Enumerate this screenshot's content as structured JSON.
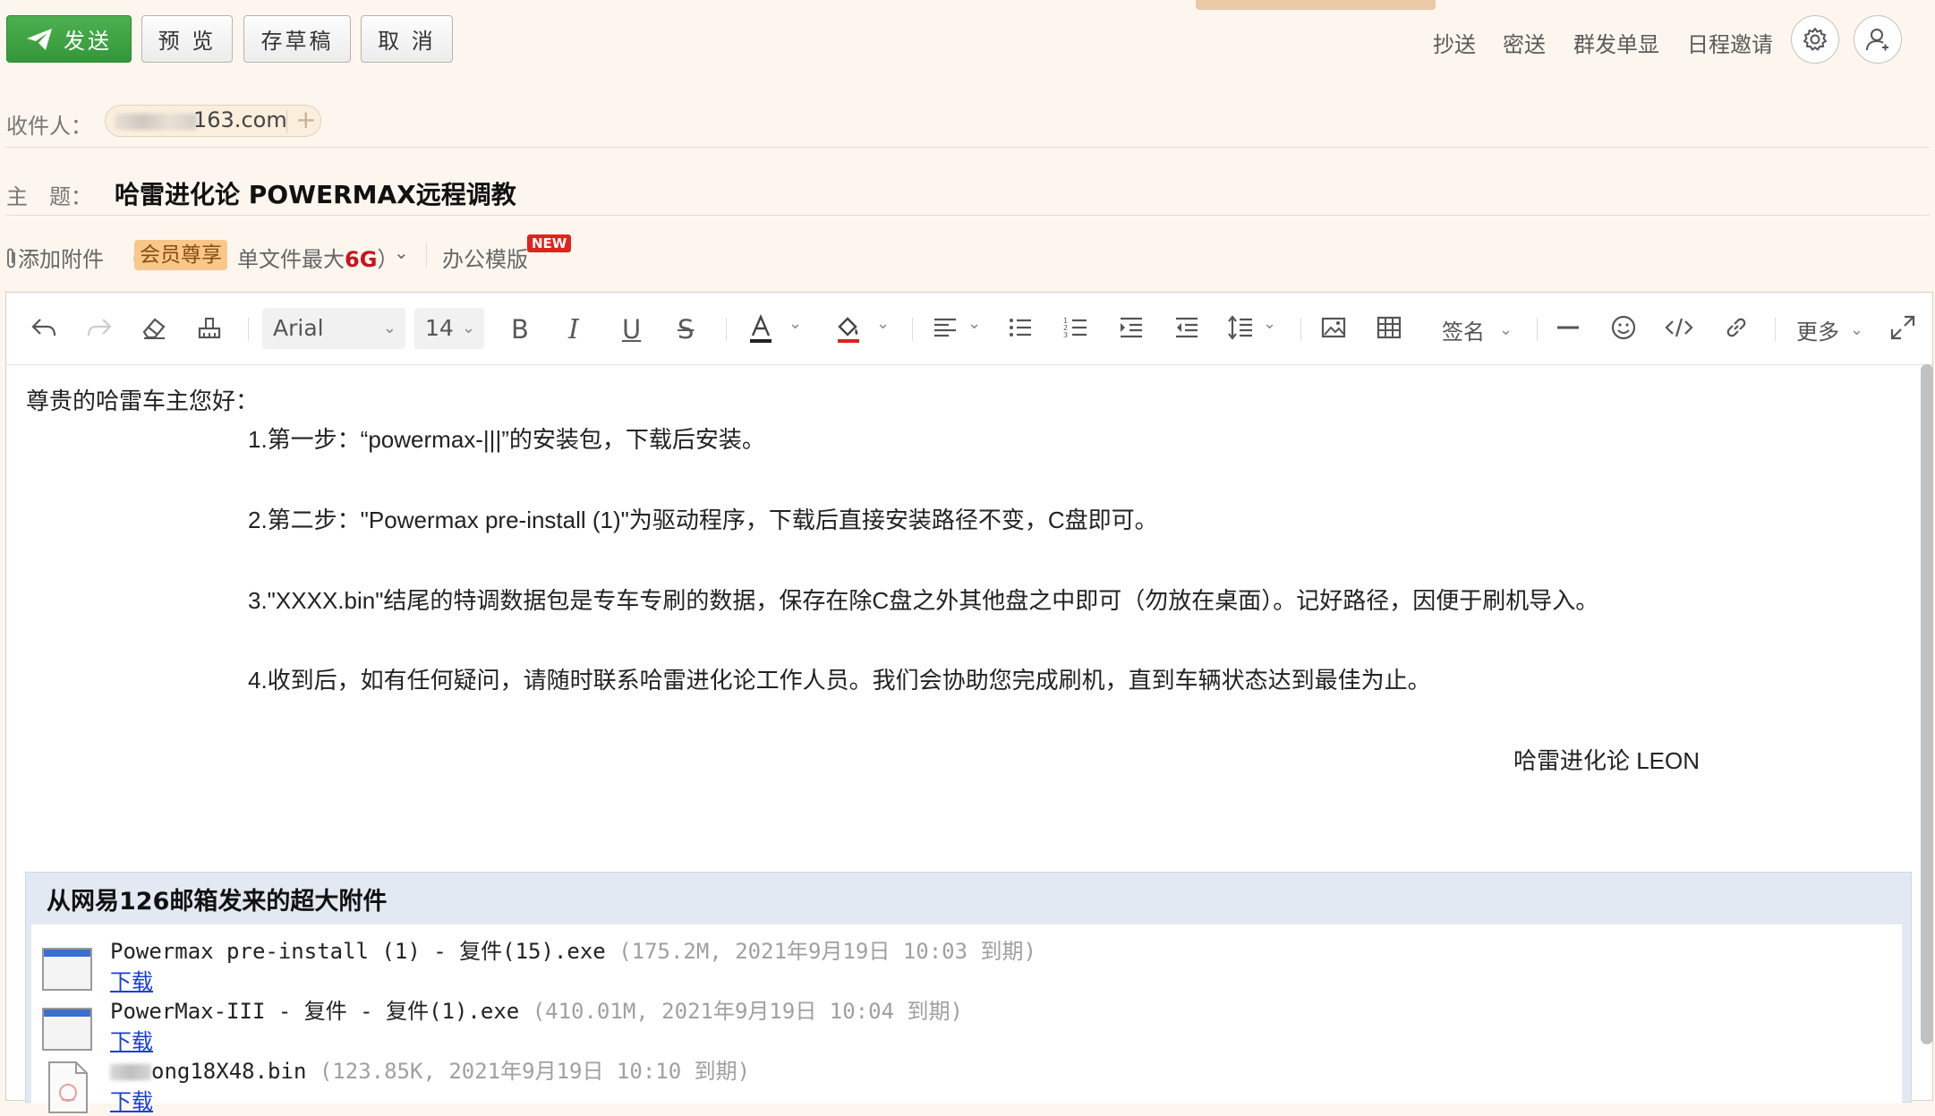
{
  "toolbar_top": {
    "send": "发送",
    "preview": "预 览",
    "draft": "存草稿",
    "cancel": "取 消",
    "links": [
      "抄送",
      "密送",
      "群发单显",
      "日程邀请"
    ]
  },
  "recipient": {
    "label": "收件人：",
    "chip_text": "163.com",
    "add": "+"
  },
  "subject": {
    "label": "主　题：",
    "value": "哈雷进化论 POWERMAX远程调教"
  },
  "attach": {
    "add_label": "添加附件",
    "paren_open": "（",
    "vip": "会员尊享",
    "limit_prefix": "单文件最大",
    "limit_value": "6G",
    "paren_close": "）",
    "office": "办公模版",
    "new_badge": "NEW"
  },
  "editor_toolbar": {
    "font_family": "Arial",
    "font_size": "14",
    "signature": "签名",
    "more": "更多"
  },
  "body": {
    "greeting": "尊贵的哈雷车主您好：",
    "lines": [
      "1.第一步：“powermax-|||”的安装包，下载后安装。",
      "2.第二步：\"Powermax pre-install (1)\"为驱动程序，下载后直接安装路径不变，C盘即可。",
      "3.\"XXXX.bin\"结尾的特调数据包是专车专刷的数据，保存在除C盘之外其他盘之中即可（勿放在桌面）。记好路径，因便于刷机导入。",
      "4.收到后，如有任何疑问，请随时联系哈雷进化论工作人员。我们会协助您完成刷机，直到车辆状态达到最佳为止。"
    ],
    "signature": "哈雷进化论 LEON"
  },
  "big_attachments": {
    "title": "从网易126邮箱发来的超大附件",
    "download": "下载",
    "items": [
      {
        "name": "Powermax pre-install (1) - 复件(15).exe",
        "meta": "(175.2M, 2021年9月19日 10:03 到期)"
      },
      {
        "name": "PowerMax-III - 复件 - 复件(1).exe",
        "meta": "(410.01M, 2021年9月19日 10:04 到期)"
      },
      {
        "name": "ong18X48.bin",
        "meta": "(123.85K, 2021年9月19日 10:10 到期)"
      }
    ]
  },
  "colors": {
    "background": "#fcf6ee",
    "send_button": "#3fa645",
    "link_blue": "#1a3fd6",
    "attach_header_bg": "#e2e9f3",
    "vip_bg": "#f8c88b",
    "new_badge": "#e0241c"
  }
}
